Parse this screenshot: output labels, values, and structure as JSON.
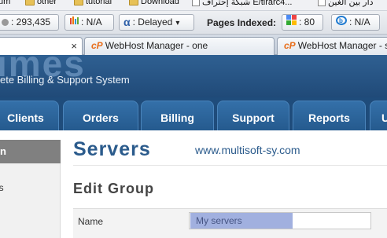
{
  "bookmarks": {
    "items": [
      {
        "label": "um"
      },
      {
        "label": "other"
      },
      {
        "label": "tutorial"
      },
      {
        "label": "Download"
      },
      {
        "label": "شبكة إحتراف E/tirarc4..."
      },
      {
        "label": "دار بين الغين"
      }
    ]
  },
  "toolbar": {
    "alexa_value": "293,435",
    "stat_value": "N/A",
    "delayed_label": "Delayed",
    "pages_indexed_label": "Pages Indexed:",
    "google_value": "80",
    "bing_value": "N/A"
  },
  "tabs": [
    {
      "label": "",
      "close": "×"
    },
    {
      "label": "WebHost Manager - one"
    },
    {
      "label": "WebHost Manager - s"
    }
  ],
  "site": {
    "logo_text": "imes",
    "tagline": "ete Billing & Support System",
    "nav": [
      {
        "label": "Clients"
      },
      {
        "label": "Orders"
      },
      {
        "label": "Billing"
      },
      {
        "label": "Support"
      },
      {
        "label": "Reports"
      },
      {
        "label": "U"
      }
    ]
  },
  "sidebar": {
    "header": "n",
    "item": "gs"
  },
  "main": {
    "page_title": "Servers",
    "page_url": "www.multisoft-sy.com",
    "section_title": "Edit Group",
    "form": {
      "name_label": "Name",
      "name_value": "My servers"
    }
  },
  "colors": {
    "nav_bg": "#1f4c7b",
    "tab_bg": "#2d6aa3",
    "title_blue": "#2b5b8c",
    "selection": "#5470c4"
  }
}
